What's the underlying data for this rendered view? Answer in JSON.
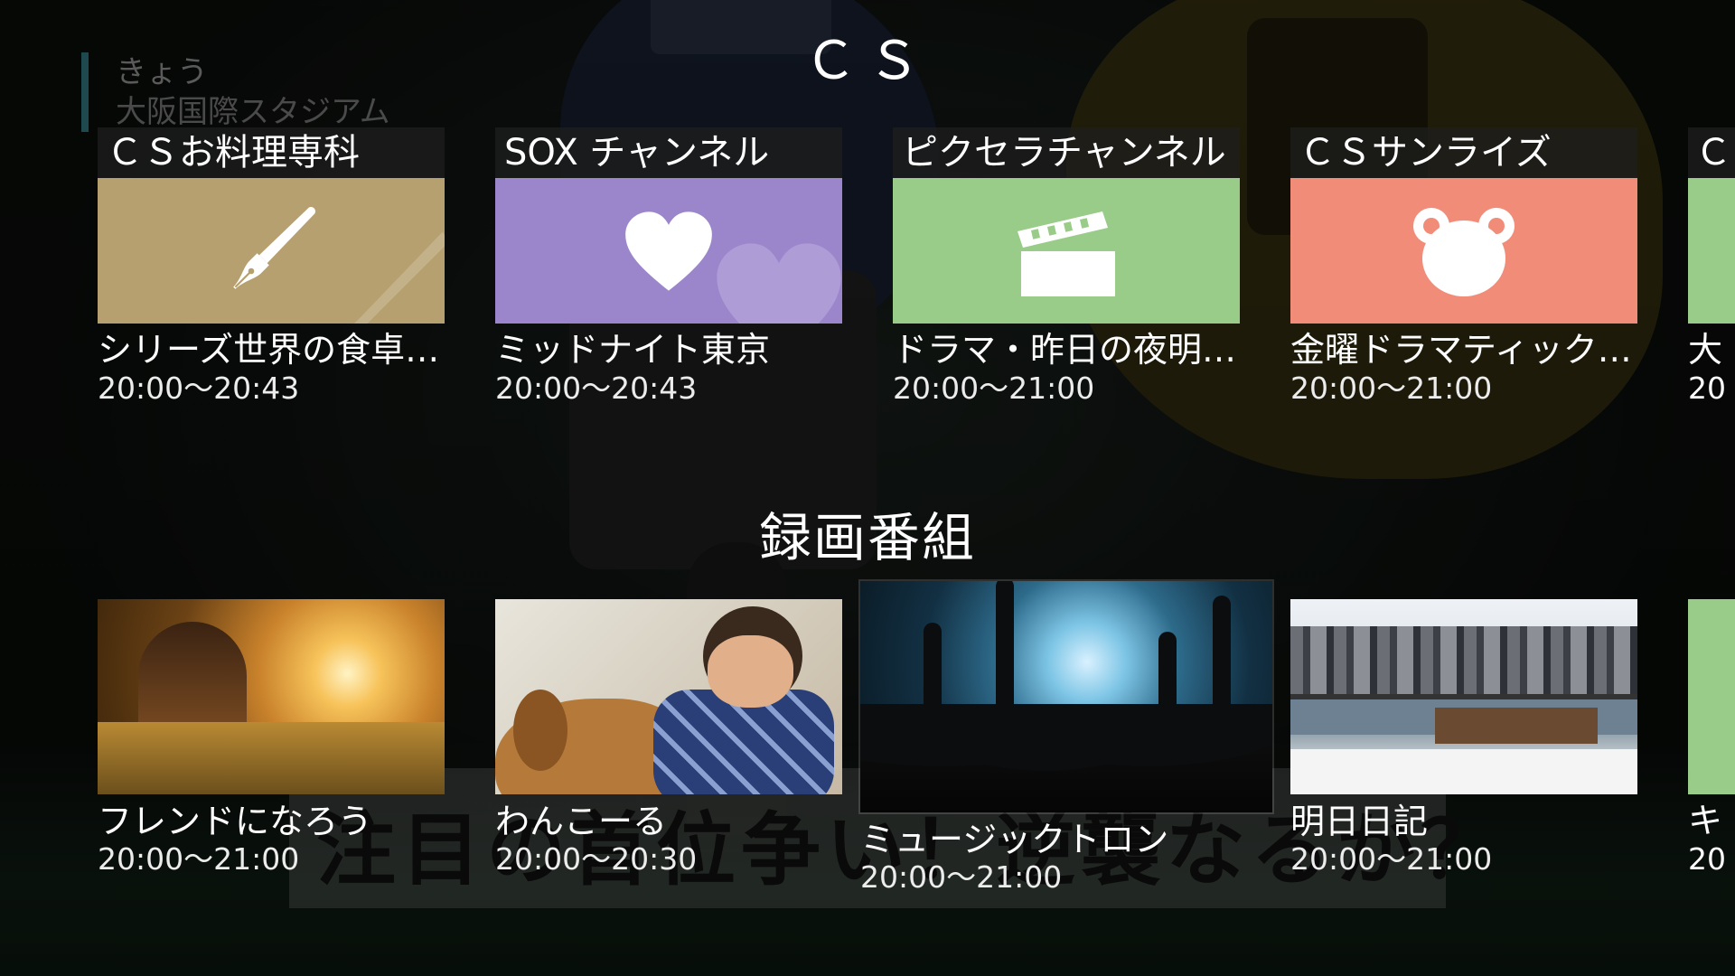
{
  "background": {
    "day_label": "きょう",
    "venue_label": "大阪国際スタジアム",
    "ticker_text": "注目の首位争い！逆襲なるか？"
  },
  "sections": {
    "cs_title": "ＣＳ",
    "recorded_title": "録画番組"
  },
  "channels": [
    {
      "name": "ＣＳお料理専科",
      "program": "シリーズ世界の食卓…",
      "time": "20:00〜20:43",
      "icon": "pen-nib-icon",
      "color": "#b6a070"
    },
    {
      "name": "SOX チャンネル",
      "program": "ミッドナイト東京",
      "time": "20:00〜20:43",
      "icon": "heart-icon",
      "color": "#9b86cc"
    },
    {
      "name": "ピクセラチャンネル",
      "program": "ドラマ・昨日の夜明…",
      "time": "20:00〜21:00",
      "icon": "clapperboard-icon",
      "color": "#99cc88"
    },
    {
      "name": "ＣＳサンライズ",
      "program": "金曜ドラマティック…",
      "time": "20:00〜21:00",
      "icon": "bear-icon",
      "color": "#f18c78"
    },
    {
      "name": "Ｃ",
      "program": "大",
      "time": "20",
      "icon": "",
      "color": "#99cc88"
    }
  ],
  "recorded": [
    {
      "title": "フレンドになろう",
      "time": "20:00〜21:00"
    },
    {
      "title": "わんこーる",
      "time": "20:00〜20:30"
    },
    {
      "title": "ミュージックトロン",
      "time": "20:00〜21:00"
    },
    {
      "title": "明日日記",
      "time": "20:00〜21:00"
    },
    {
      "title": "キ",
      "time": "20"
    }
  ]
}
